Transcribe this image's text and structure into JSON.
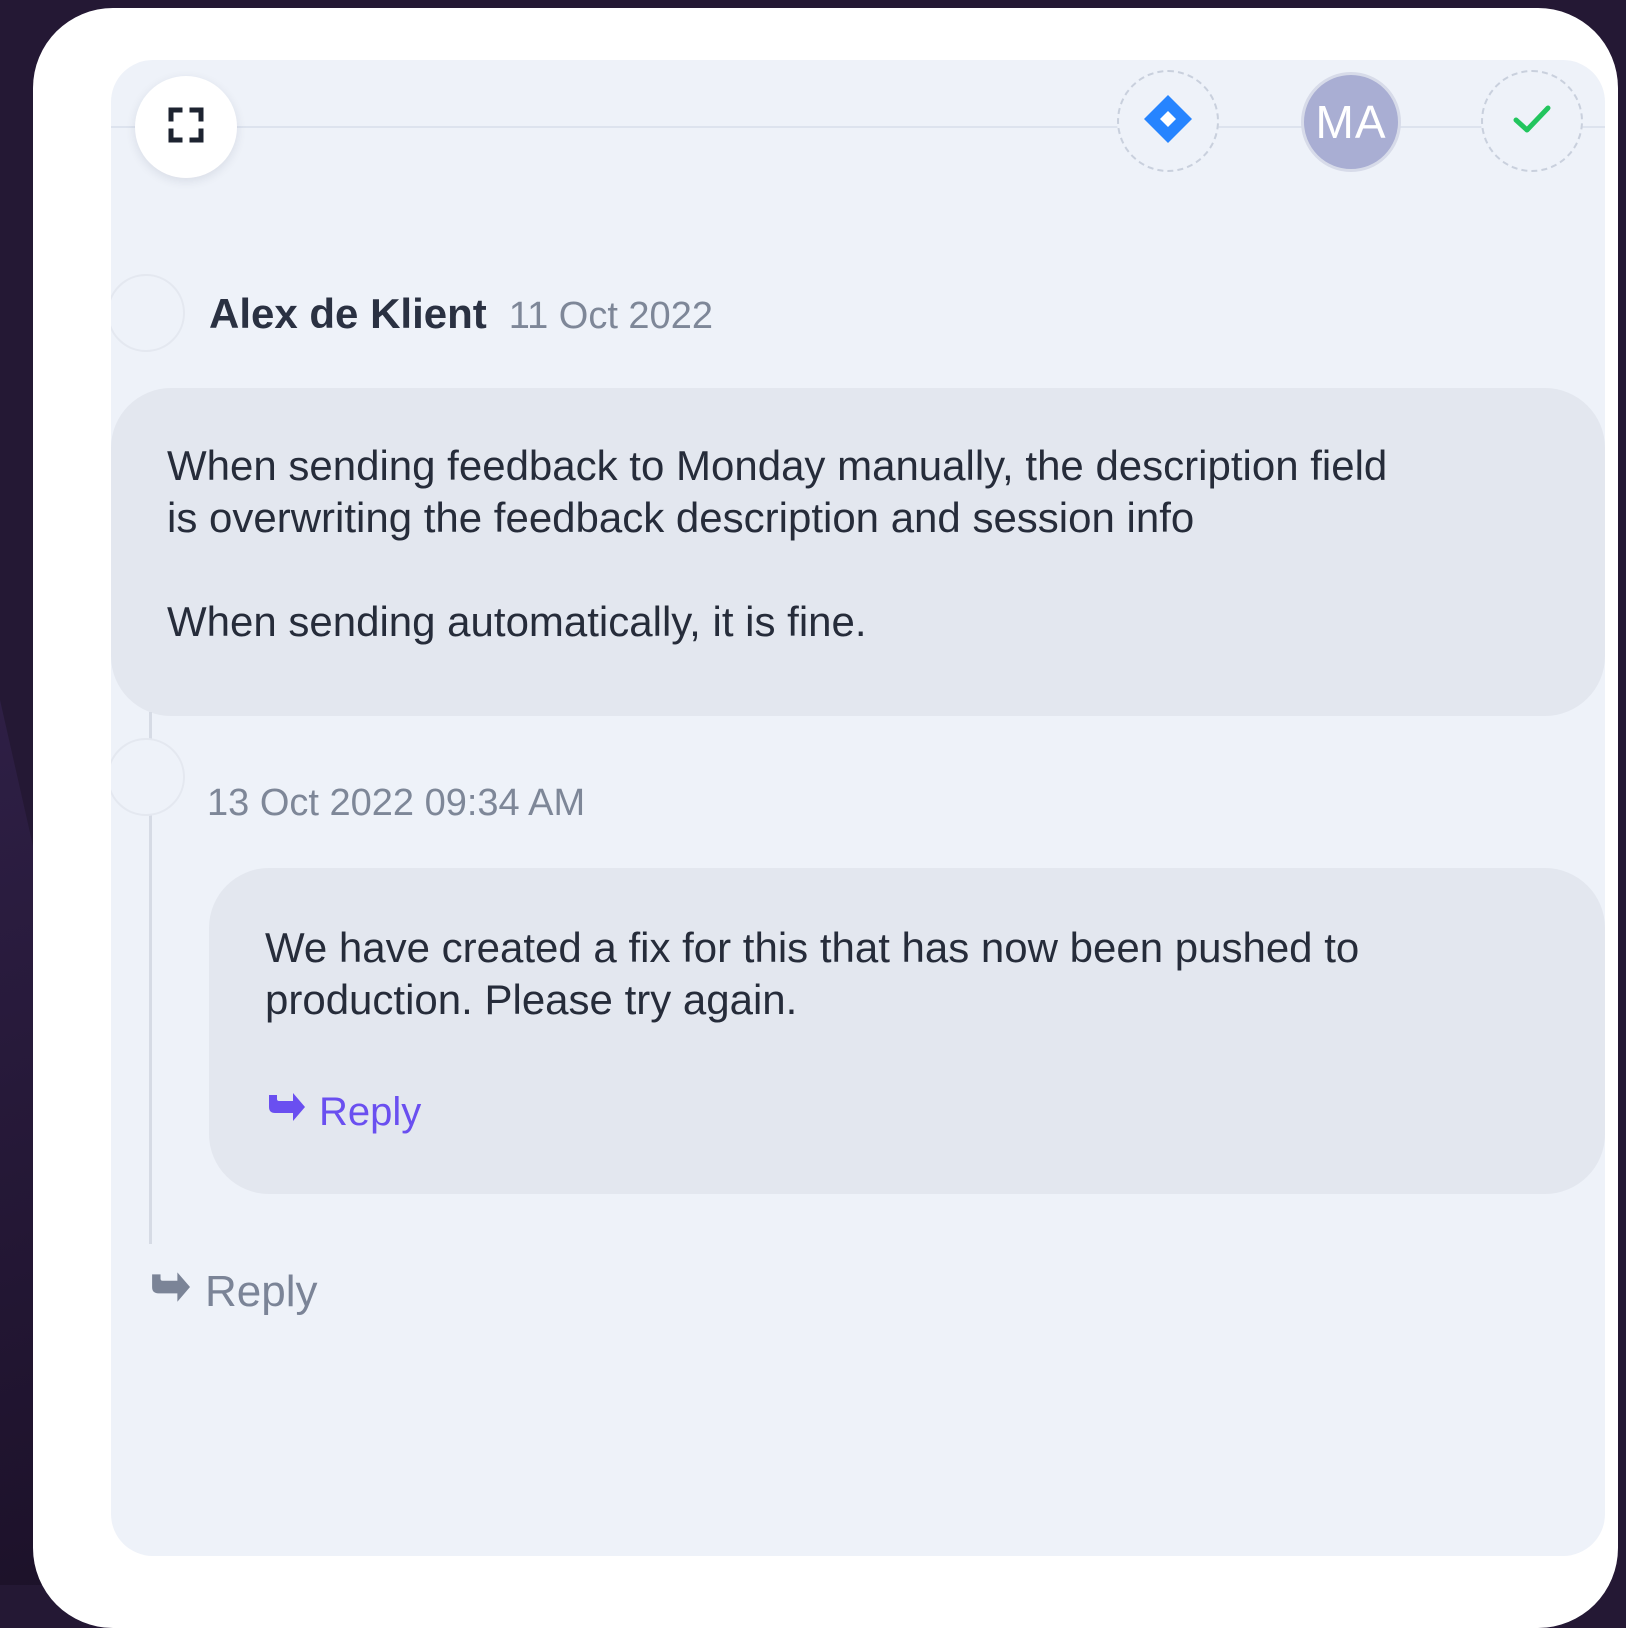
{
  "header": {
    "icons": {
      "expand": "expand-icon",
      "jira": "jira-icon",
      "resolve": "check-icon"
    },
    "assignee_initials": "MA",
    "colors": {
      "jira": "#2684ff",
      "check": "#22c55e",
      "avatar": "#a9aed3"
    }
  },
  "comment": {
    "author": "Alex de Klient",
    "date": "11 Oct 2022",
    "lines": [
      "When sending feedback to Monday manually, the description field",
      "is overwriting the feedback description and session info"
    ],
    "second_paragraph": "When sending automatically, it is fine."
  },
  "reply": {
    "timestamp": "13 Oct 2022 09:34 AM",
    "lines": [
      "We have created a fix for this that has now been pushed to",
      "production. Please try again."
    ],
    "reply_label": "Reply",
    "accent_color": "#6a4ff0"
  },
  "footer": {
    "reply_label": "Reply"
  }
}
